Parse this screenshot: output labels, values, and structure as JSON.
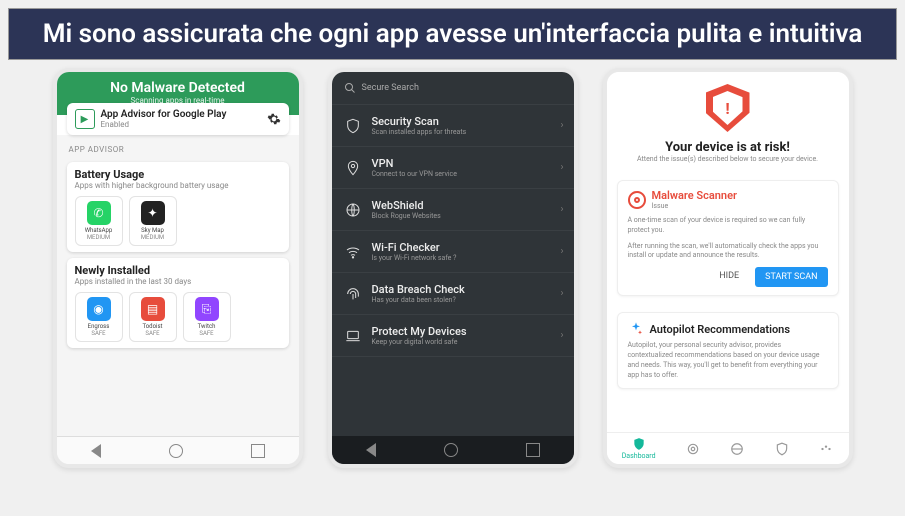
{
  "banner": {
    "text": "Mi sono assicurata che ogni app avesse un'interfaccia pulita e intuitiva"
  },
  "phone1": {
    "header_title": "No Malware Detected",
    "header_sub": "Scanning apps in real-time",
    "advisor_title": "App Advisor for Google Play",
    "advisor_status": "Enabled",
    "section_label": "APP ADVISOR",
    "battery_title": "Battery Usage",
    "battery_sub": "Apps with higher background battery usage",
    "battery_apps": [
      {
        "name": "WhatsApp",
        "status": "MEDIUM",
        "bg": "#25d366"
      },
      {
        "name": "Sky Map",
        "status": "MEDIUM",
        "bg": "#222"
      }
    ],
    "newly_title": "Newly Installed",
    "newly_sub": "Apps installed in the last 30 days",
    "newly_apps": [
      {
        "name": "Engross",
        "status": "SAFE",
        "bg": "#2196f3"
      },
      {
        "name": "Todoist",
        "status": "SAFE",
        "bg": "#e74c3c"
      },
      {
        "name": "Twitch",
        "status": "SAFE",
        "bg": "#9146ff"
      }
    ]
  },
  "phone2": {
    "search_placeholder": "Secure Search",
    "rows": [
      {
        "title": "Security Scan",
        "sub": "Scan installed apps for threats"
      },
      {
        "title": "VPN",
        "sub": "Connect to our VPN service"
      },
      {
        "title": "WebShield",
        "sub": "Block Rogue Websites"
      },
      {
        "title": "Wi-Fi Checker",
        "sub": "Is your Wi-Fi network safe ?"
      },
      {
        "title": "Data Breach Check",
        "sub": "Has your data been stolen?"
      },
      {
        "title": "Protect My Devices",
        "sub": "Keep your digital world safe"
      }
    ]
  },
  "phone3": {
    "risk_title": "Your device is at risk!",
    "risk_sub": "Attend the issue(s) described below to secure your device.",
    "malware_title": "Malware Scanner",
    "malware_issue": "Issue",
    "malware_text1": "A one-time scan of your device is required so we can fully protect you.",
    "malware_text2": "After running the scan, we'll automatically check the apps you install or update and announce the results.",
    "hide_label": "HIDE",
    "scan_label": "START SCAN",
    "autopilot_title": "Autopilot Recommendations",
    "autopilot_text": "Autopilot, your personal security advisor, provides contextualized recommendations based on your device usage and needs. This way, you'll get to benefit from everything your app has to offer.",
    "tab_dashboard": "Dashboard"
  }
}
